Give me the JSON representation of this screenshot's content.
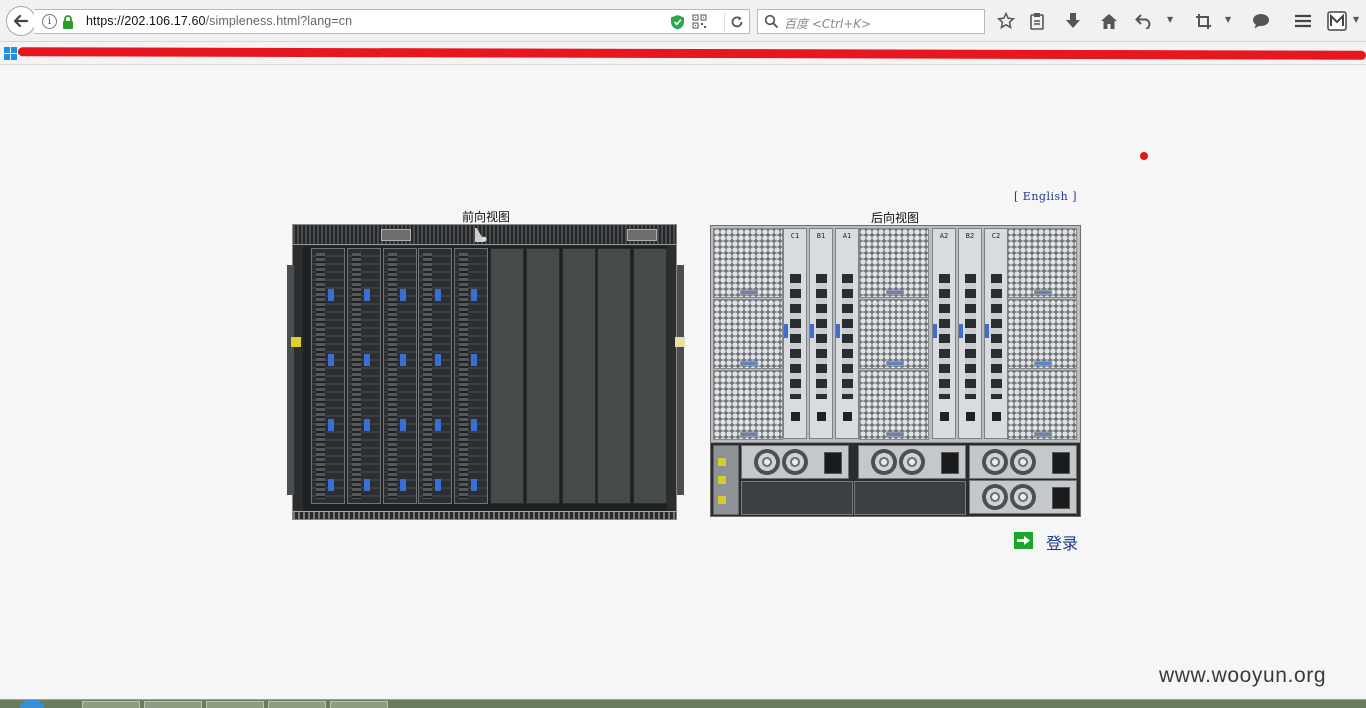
{
  "browser": {
    "url_host": "https://202.106.17.60",
    "url_path": "/simpleness.html?lang=cn",
    "search_placeholder": "百度 <Ctrl+K>",
    "info_glyph": "i"
  },
  "page": {
    "language_link": "[ English ]",
    "front_view_title": "前向视图",
    "rear_view_title": "后向视图",
    "rear_switch_labels": [
      "C1",
      "B1",
      "A1",
      "A2",
      "B2",
      "C2"
    ],
    "login_label": "登录"
  },
  "watermark": "www.wooyun.org",
  "colors": {
    "link": "#1a3a8a",
    "login_icon": "#1ba52a",
    "redaction": "#e8161f",
    "page_bg": "#f6f6f6"
  },
  "icons": {
    "back": "arrow-left-icon",
    "info": "info-icon",
    "lock": "lock-icon",
    "shield": "shield-icon",
    "qr": "qr-code-icon",
    "reload": "reload-icon",
    "search": "search-icon",
    "bookmark_star": "star-icon",
    "reading_list": "clipboard-icon",
    "download": "download-icon",
    "home": "home-icon",
    "undo": "undo-icon",
    "crop": "crop-icon",
    "chat": "chat-icon",
    "menu": "menu-icon",
    "addon": "addon-icon"
  }
}
